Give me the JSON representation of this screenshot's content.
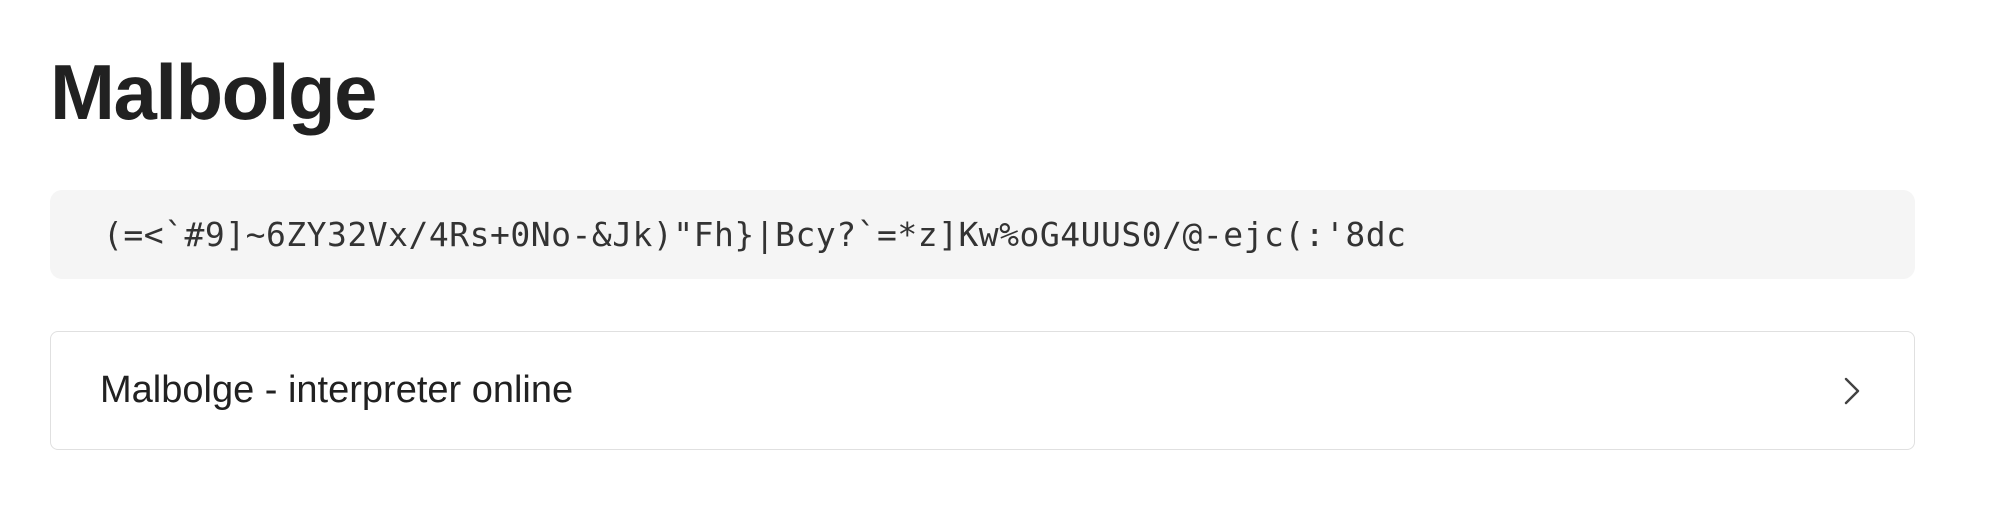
{
  "page": {
    "title": "Malbolge"
  },
  "code_block": {
    "code": "(=<`#9]~6ZY32Vx/4Rs+0No-&Jk)\"Fh}|Bcy?`=*z]Kw%oG4UUS0/@-ejc(:'8dc"
  },
  "link_card": {
    "label": "Malbolge - interpreter online",
    "icon": "chevron-right-icon"
  },
  "colors": {
    "text": "#212121",
    "code_background": "#f5f5f5",
    "card_border": "#e0e0e0"
  }
}
